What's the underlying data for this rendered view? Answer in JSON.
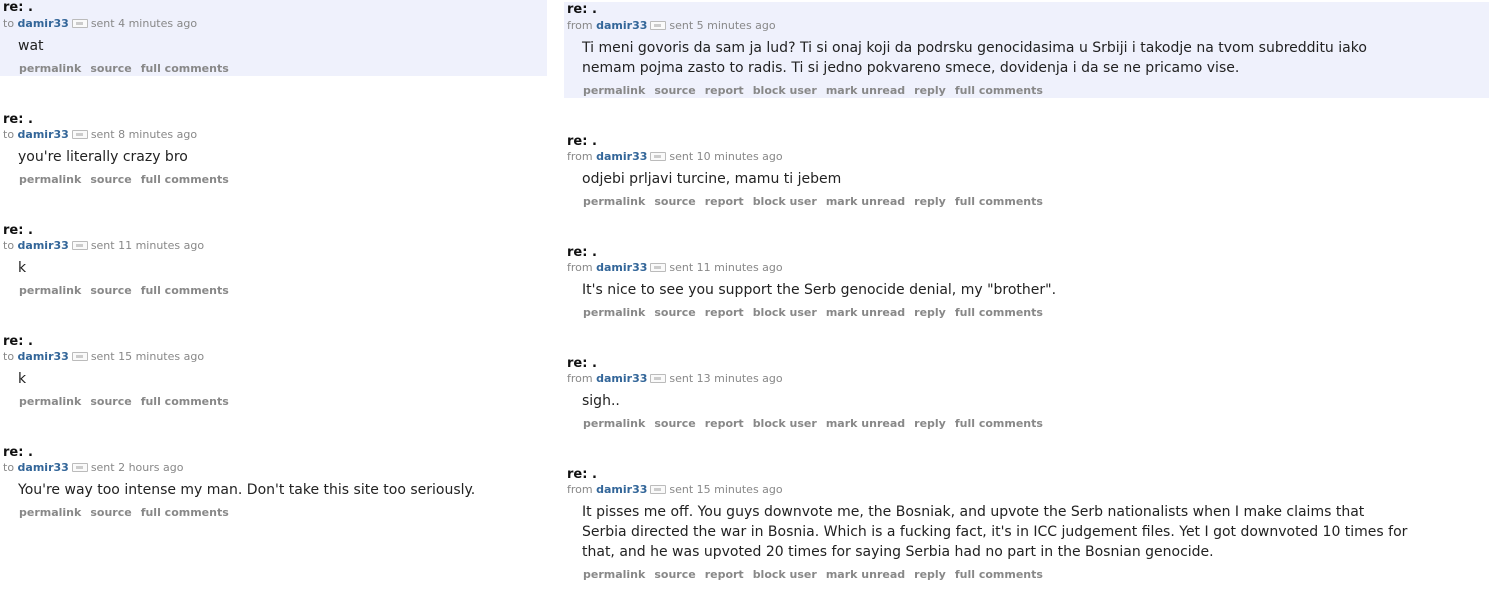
{
  "left": [
    {
      "subject": "re: .",
      "dir": "to",
      "user": "damir33",
      "sent": "sent 4 minutes ago",
      "body": "wat",
      "links": [
        "permalink",
        "source",
        "full comments"
      ]
    },
    {
      "subject": "re: .",
      "dir": "to",
      "user": "damir33",
      "sent": "sent 8 minutes ago",
      "body": "you're literally crazy bro",
      "links": [
        "permalink",
        "source",
        "full comments"
      ]
    },
    {
      "subject": "re: .",
      "dir": "to",
      "user": "damir33",
      "sent": "sent 11 minutes ago",
      "body": "k",
      "links": [
        "permalink",
        "source",
        "full comments"
      ]
    },
    {
      "subject": "re: .",
      "dir": "to",
      "user": "damir33",
      "sent": "sent 15 minutes ago",
      "body": "k",
      "links": [
        "permalink",
        "source",
        "full comments"
      ]
    },
    {
      "subject": "re: .",
      "dir": "to",
      "user": "damir33",
      "sent": "sent 2 hours ago",
      "body": "You're way too intense my man. Don't take this site too seriously.",
      "links": [
        "permalink",
        "source",
        "full comments"
      ]
    }
  ],
  "right": [
    {
      "subject": "re: .",
      "dir": "from",
      "user": "damir33",
      "sent": "sent 5 minutes ago",
      "body": [
        "Ti meni govoris da sam ja lud? Ti si onaj koji da podrsku genocidasima u Srbiji i takodje na tvom subredditu iako",
        "nemam pojma zasto to radis. Ti si jedno pokvareno smece, dovidenja i da se ne pricamo vise."
      ],
      "links": [
        "permalink",
        "source",
        "report",
        "block user",
        "mark unread",
        "reply",
        "full comments"
      ]
    },
    {
      "subject": "re: .",
      "dir": "from",
      "user": "damir33",
      "sent": "sent 10 minutes ago",
      "body": [
        "odjebi prljavi turcine, mamu ti jebem"
      ],
      "links": [
        "permalink",
        "source",
        "report",
        "block user",
        "mark unread",
        "reply",
        "full comments"
      ]
    },
    {
      "subject": "re: .",
      "dir": "from",
      "user": "damir33",
      "sent": "sent 11 minutes ago",
      "body": [
        "It's nice to see you support the Serb genocide denial, my \"brother\"."
      ],
      "links": [
        "permalink",
        "source",
        "report",
        "block user",
        "mark unread",
        "reply",
        "full comments"
      ]
    },
    {
      "subject": "re: .",
      "dir": "from",
      "user": "damir33",
      "sent": "sent 13 minutes ago",
      "body": [
        "sigh.."
      ],
      "links": [
        "permalink",
        "source",
        "report",
        "block user",
        "mark unread",
        "reply",
        "full comments"
      ]
    },
    {
      "subject": "re: .",
      "dir": "from",
      "user": "damir33",
      "sent": "sent 15 minutes ago",
      "body": [
        "It pisses me off. You guys downvote me, the Bosniak, and upvote the Serb nationalists when I make claims that",
        "Serbia directed the war in Bosnia. Which is a fucking fact, it's in ICC judgement files. Yet I got downvoted 10 times for",
        "that, and he was upvoted 20 times for saying Serbia had no part in the Bosnian genocide."
      ],
      "links": [
        "permalink",
        "source",
        "report",
        "block user",
        "mark unread",
        "reply",
        "full comments"
      ]
    }
  ]
}
